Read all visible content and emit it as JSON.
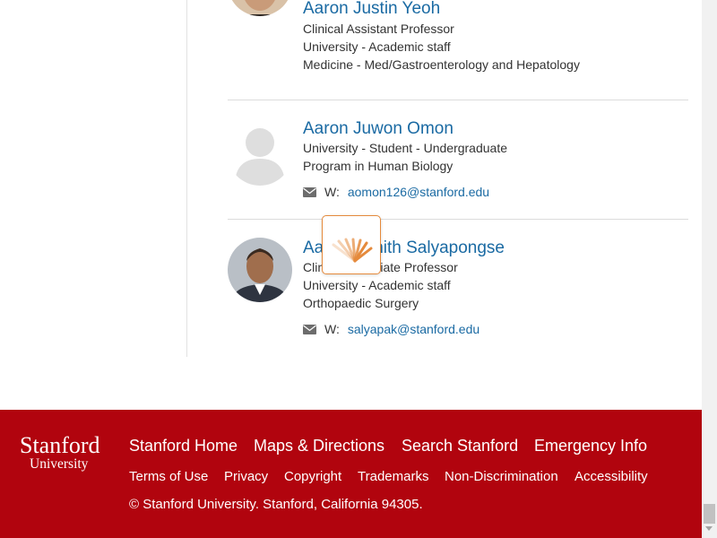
{
  "people": [
    {
      "name": "Aaron Justin Yeoh",
      "lines": [
        "Clinical Assistant Professor",
        "University - Academic staff",
        "Medicine - Med/Gastroenterology and Hepatology"
      ]
    },
    {
      "name": "Aaron Juwon Omon",
      "lines": [
        "University - Student - Undergraduate",
        "Program in Human Biology"
      ],
      "email_label": "W:",
      "email": "aomon126@stanford.edu"
    },
    {
      "name": "Aaron Sanith Salyapongse",
      "lines": [
        "Clinical Associate Professor",
        "University - Academic staff",
        "Orthopaedic Surgery"
      ],
      "email_label": "W:",
      "email": "salyapak@stanford.edu"
    }
  ],
  "footer": {
    "logo_line1": "Stanford",
    "logo_line2": "University",
    "main_links": [
      "Stanford Home",
      "Maps & Directions",
      "Search Stanford",
      "Emergency Info"
    ],
    "sub_links": [
      "Terms of Use",
      "Privacy",
      "Copyright",
      "Trademarks",
      "Non-Discrimination",
      "Accessibility"
    ],
    "copyright": "© Stanford University. Stanford, California 94305."
  },
  "colors": {
    "link": "#1a6aa3",
    "footer_bg": "#b1040e",
    "loader_accent": "#e58a3c"
  },
  "icons": [
    "envelope-icon",
    "loading-spinner-icon",
    "default-avatar-icon"
  ]
}
